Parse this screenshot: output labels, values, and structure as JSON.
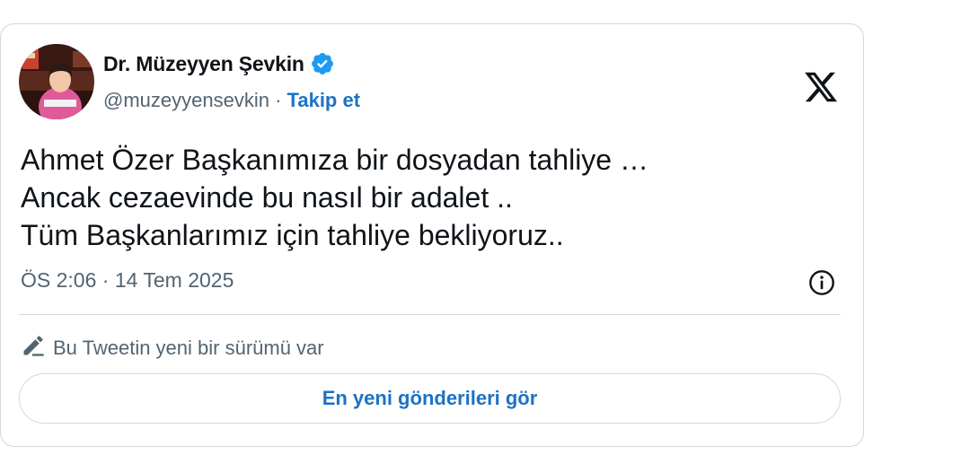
{
  "author": {
    "name": "Dr. Müzeyyen Şevkin",
    "handle": "@muzeyyensevkin",
    "separator": "·",
    "follow_label": "Takip et",
    "avatar_icon": "profile-photo",
    "verified_icon": "verified-badge-icon",
    "verified_color": "#1d9bf0"
  },
  "brand": {
    "logo_icon": "x-logo-icon"
  },
  "tweet": {
    "lines": [
      "Ahmet Özer Başkanımıza bir dosyadan tahliye …",
      "Ancak cezaevinde bu nasıl bir adalet ..",
      "Tüm Başkanlarımız için tahliye bekliyoruz.."
    ],
    "timestamp": "ÖS 2:06 · 14 Tem 2025",
    "info_icon": "info-icon"
  },
  "edit_notice": {
    "icon": "pencil-icon",
    "text": "Bu Tweetin yeni bir sürümü var"
  },
  "cta": {
    "label": "En yeni gönderileri gör"
  },
  "colors": {
    "link": "#1d72c4",
    "secondary_text": "#536471",
    "border": "#cfd9de",
    "primary_text": "#0f1419"
  }
}
